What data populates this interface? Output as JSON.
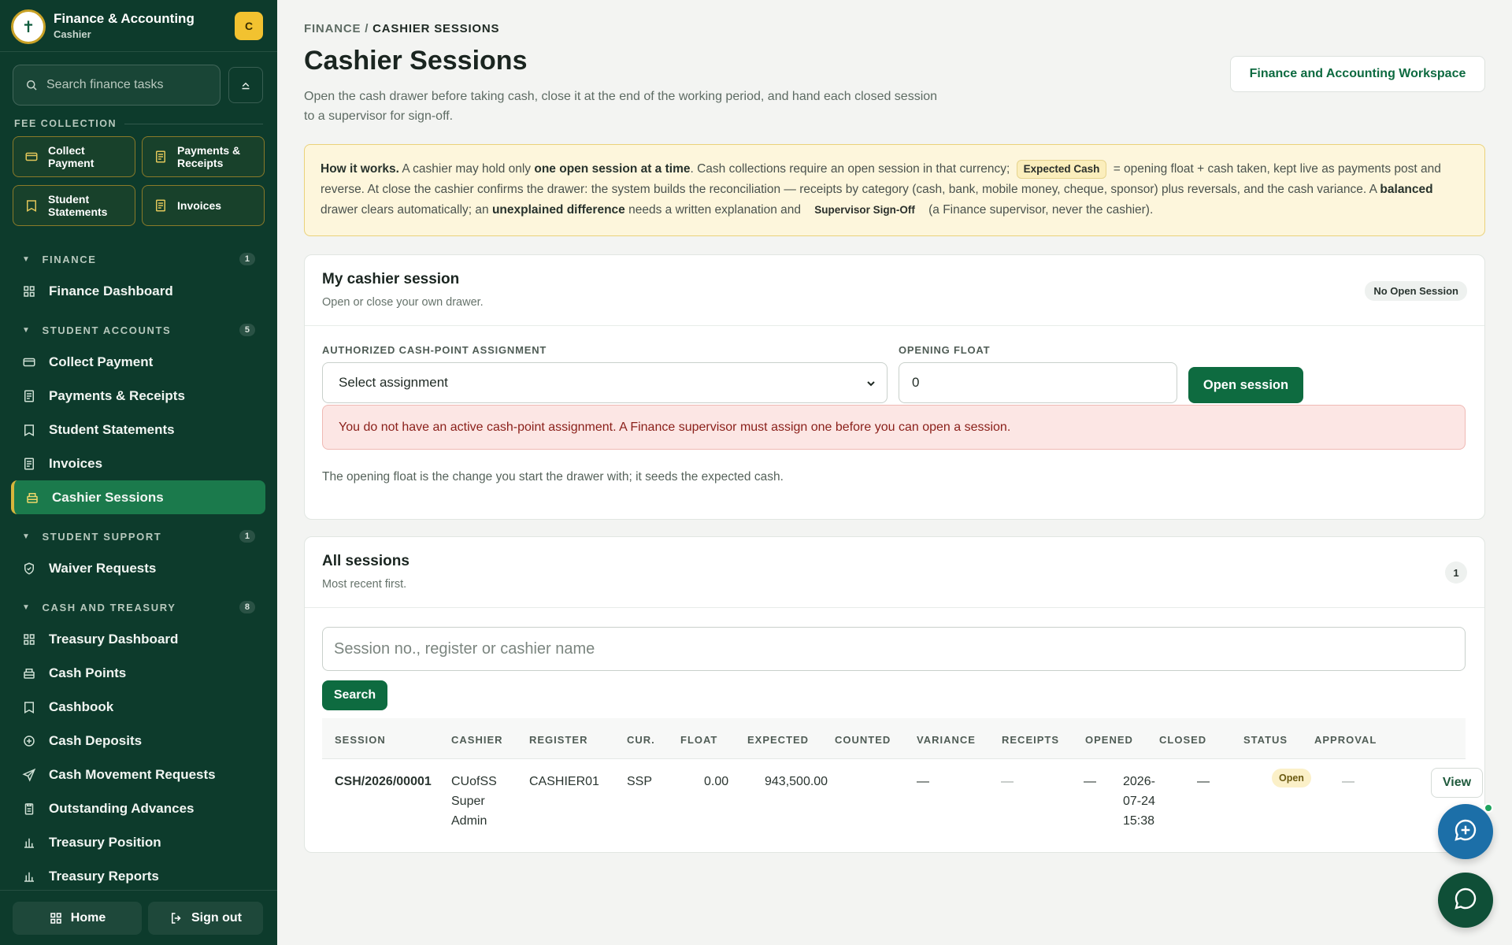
{
  "sidebar": {
    "org_title": "Finance & Accounting",
    "org_subtitle": "Cashier",
    "avatar_initial": "C",
    "search_placeholder": "Search finance tasks",
    "quick_label": "FEE COLLECTION",
    "quick_actions": [
      {
        "label": "Collect Payment",
        "icon": "card-icon"
      },
      {
        "label": "Payments & Receipts",
        "icon": "receipt-icon"
      },
      {
        "label": "Student Statements",
        "icon": "book-icon"
      },
      {
        "label": "Invoices",
        "icon": "receipt-icon"
      }
    ],
    "sections": [
      {
        "title": "FINANCE",
        "count": "1",
        "items": [
          "Finance Dashboard"
        ]
      },
      {
        "title": "STUDENT ACCOUNTS",
        "count": "5",
        "items": [
          "Collect Payment",
          "Payments & Receipts",
          "Student Statements",
          "Invoices",
          "Cashier Sessions"
        ]
      },
      {
        "title": "STUDENT SUPPORT",
        "count": "1",
        "items": [
          "Waiver Requests"
        ]
      },
      {
        "title": "CASH AND TREASURY",
        "count": "8",
        "items": [
          "Treasury Dashboard",
          "Cash Points",
          "Cashbook",
          "Cash Deposits",
          "Cash Movement Requests",
          "Outstanding Advances",
          "Treasury Position",
          "Treasury Reports"
        ]
      }
    ],
    "active_item": "Cashier Sessions",
    "footer": {
      "home": "Home",
      "signout": "Sign out"
    }
  },
  "page": {
    "crumb_parent": "FINANCE",
    "crumb_sep": " / ",
    "crumb_current": "CASHIER SESSIONS",
    "title": "Cashier Sessions",
    "description": "Open the cash drawer before taking cash, close it at the end of the working period, and hand each closed session to a supervisor for sign-off.",
    "workspace_button": "Finance and Accounting Workspace"
  },
  "info": {
    "p1": "How it works.",
    "p2": " A cashier may hold only ",
    "p3": "one open session at a time",
    "p4": ". Cash collections require an open session in that currency; ",
    "tag1": "Expected Cash",
    "p5": " = opening float + cash taken, kept live as payments post and reverse. At close the cashier confirms the drawer: the system builds the reconciliation — receipts by category (cash, bank, mobile money, cheque, sponsor) plus reversals, and the cash variance. A ",
    "p6": "balanced",
    "p7": " drawer clears automatically; an ",
    "p8": "unexplained difference",
    "p9": " needs a written explanation and ",
    "tag2": "Supervisor Sign-Off",
    "p10": " (a Finance supervisor, never the cashier)."
  },
  "my_session": {
    "title": "My cashier session",
    "subtitle": "Open or close your own drawer.",
    "status": "No Open Session",
    "assignment_label": "AUTHORIZED CASH-POINT ASSIGNMENT",
    "assignment_value": "Select assignment",
    "float_label": "OPENING FLOAT",
    "float_value": "0",
    "open_button": "Open session",
    "alert": "You do not have an active cash-point assignment. A Finance supervisor must assign one before you can open a session.",
    "hint": "The opening float is the change you start the drawer with; it seeds the expected cash."
  },
  "all_sessions": {
    "title": "All sessions",
    "subtitle": "Most recent first.",
    "count": "1",
    "search_placeholder": "Session no., register or cashier name",
    "search_button": "Search",
    "columns": [
      "SESSION",
      "CASHIER",
      "REGISTER",
      "CUR.",
      "FLOAT",
      "EXPECTED",
      "COUNTED",
      "VARIANCE",
      "RECEIPTS",
      "OPENED",
      "CLOSED",
      "STATUS",
      "APPROVAL"
    ],
    "rows": [
      {
        "session": "CSH/2026/00001",
        "cashier": [
          "CUofSS",
          "Super",
          "Admin"
        ],
        "register": "CASHIER01",
        "currency": "SSP",
        "float": "0.00",
        "expected": "943,500.00",
        "counted": "—",
        "variance": "—",
        "receipts": "—",
        "opened": [
          "2026-",
          "07-24",
          "15:38"
        ],
        "closed": "—",
        "status": "Open",
        "approval": "—",
        "action": "View"
      }
    ]
  },
  "colors": {
    "sidebar": "#0d3b2c",
    "accent": "#0e6b40",
    "gold": "#c9a227"
  }
}
